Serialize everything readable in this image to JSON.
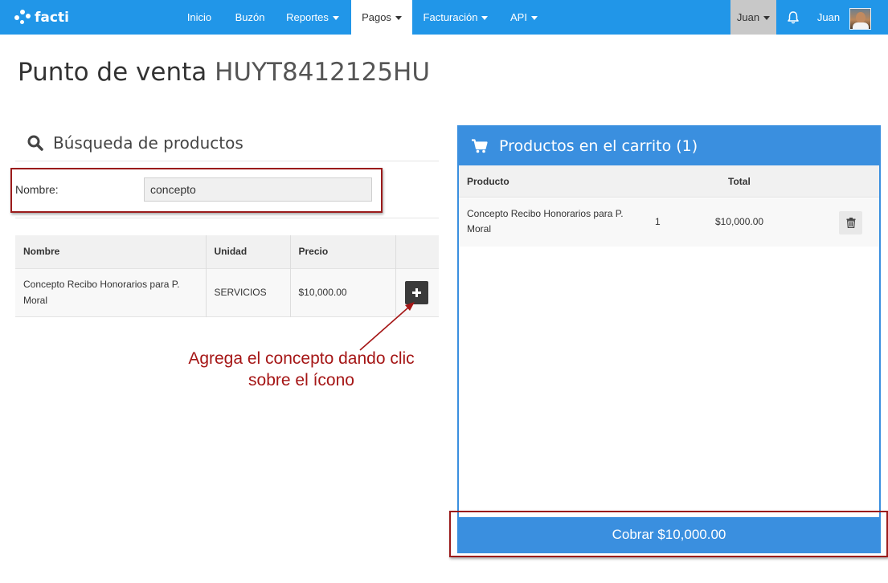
{
  "nav": {
    "brand": "facti",
    "items": [
      {
        "label": "Inicio",
        "dropdown": false
      },
      {
        "label": "Buzón",
        "dropdown": false
      },
      {
        "label": "Reportes",
        "dropdown": true
      },
      {
        "label": "Pagos",
        "dropdown": true,
        "active": true
      },
      {
        "label": "Facturación",
        "dropdown": true
      },
      {
        "label": "API",
        "dropdown": true
      }
    ],
    "user_menu_label": "Juan",
    "user_name": "Juan",
    "icons": {
      "notifications": "bell-icon",
      "avatar": "user-avatar"
    }
  },
  "page": {
    "title": "Punto de venta",
    "rfc": "HUYT8412125HU"
  },
  "search": {
    "heading": "Búsqueda de productos",
    "field_label": "Nombre:",
    "field_value": "concepto",
    "table": {
      "headers": [
        "Nombre",
        "Unidad",
        "Precio"
      ],
      "rows": [
        {
          "nombre": "Concepto Recibo Honorarios para P. Moral",
          "unidad": "SERVICIOS",
          "precio": "$10,000.00",
          "action_icon": "plus-icon"
        }
      ]
    }
  },
  "annotation": {
    "line1": "Agrega el concepto dando clic",
    "line2": "sobre el ícono"
  },
  "cart": {
    "title": "Productos en el carrito (1)",
    "headers": {
      "producto": "Producto",
      "total": "Total"
    },
    "rows": [
      {
        "producto": "Concepto Recibo Honorarios para P. Moral",
        "cantidad": "1",
        "total": "$10,000.00",
        "action_icon": "trash-icon"
      }
    ],
    "pay_button": "Cobrar $10,000.00"
  },
  "colors": {
    "navbar": "#2196e8",
    "panel_accent": "#3a8fdf",
    "annotation": "#a51616"
  }
}
